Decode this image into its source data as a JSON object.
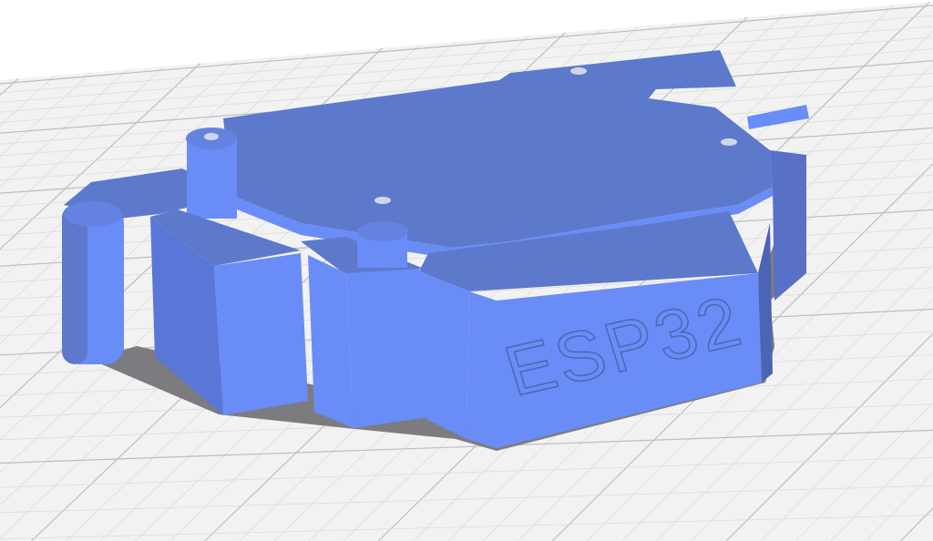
{
  "viewport": {
    "type": "3d-build-plate-view",
    "model": {
      "label_text": "ESP32",
      "colors": {
        "front": "#6a8cf7",
        "top": "#5d79cc",
        "side": "#4c64b6",
        "shadow": "#7c7c80"
      }
    },
    "build_plate": {
      "colors": {
        "floor": "#f2f2f2",
        "grid_major": "#bdbdbd",
        "grid_minor": "#dcdcdc"
      }
    }
  }
}
